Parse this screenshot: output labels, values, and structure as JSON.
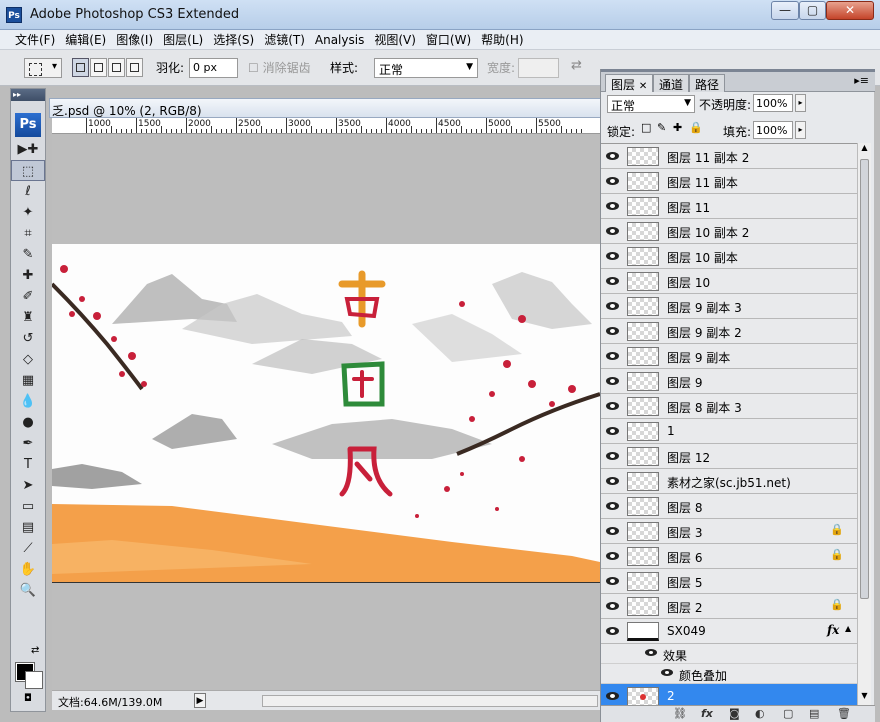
{
  "app": {
    "title": "Adobe Photoshop CS3 Extended",
    "icon_label": "Ps",
    "window_controls": {
      "minimize": "—",
      "maximize": "▢",
      "close": "✕"
    }
  },
  "menu": [
    "文件(F)",
    "编辑(E)",
    "图像(I)",
    "图层(L)",
    "选择(S)",
    "滤镜(T)",
    "Analysis",
    "视图(V)",
    "窗口(W)",
    "帮助(H)"
  ],
  "options": {
    "feather_label": "羽化:",
    "feather_value": "0 px",
    "antialias_label": "消除锯齿",
    "style_label": "样式:",
    "style_value": "正常",
    "width_label": "宽度:"
  },
  "tools": {
    "logo": "Ps",
    "grip": "▸▸",
    "items": [
      {
        "name": "move-tool-icon",
        "glyph": "▶✚"
      },
      {
        "name": "marquee-tool-icon",
        "glyph": "⬚"
      },
      {
        "name": "lasso-tool-icon",
        "glyph": "ℓ"
      },
      {
        "name": "magic-wand-tool-icon",
        "glyph": "✦"
      },
      {
        "name": "crop-tool-icon",
        "glyph": "⌗"
      },
      {
        "name": "slice-tool-icon",
        "glyph": "✎"
      },
      {
        "name": "healing-brush-tool-icon",
        "glyph": "✚"
      },
      {
        "name": "brush-tool-icon",
        "glyph": "✐"
      },
      {
        "name": "clone-stamp-tool-icon",
        "glyph": "♜"
      },
      {
        "name": "history-brush-tool-icon",
        "glyph": "↺"
      },
      {
        "name": "eraser-tool-icon",
        "glyph": "◇"
      },
      {
        "name": "gradient-tool-icon",
        "glyph": "▦"
      },
      {
        "name": "blur-tool-icon",
        "glyph": "💧"
      },
      {
        "name": "dodge-tool-icon",
        "glyph": "●"
      },
      {
        "name": "pen-tool-icon",
        "glyph": "✒"
      },
      {
        "name": "type-tool-icon",
        "glyph": "T"
      },
      {
        "name": "path-selection-tool-icon",
        "glyph": "➤"
      },
      {
        "name": "shape-tool-icon",
        "glyph": "▭"
      },
      {
        "name": "notes-tool-icon",
        "glyph": "▤"
      },
      {
        "name": "eyedropper-tool-icon",
        "glyph": "⟋"
      },
      {
        "name": "hand-tool-icon",
        "glyph": "✋"
      },
      {
        "name": "zoom-tool-icon",
        "glyph": "🔍"
      }
    ],
    "swap_colors": "⇄",
    "quick_mask": "◘"
  },
  "document": {
    "tab_title": "乏.psd @ 10% (2, RGB/8)",
    "ruler_labels": [
      "1000",
      "1500",
      "2000",
      "2500",
      "3000",
      "3500",
      "4000",
      "4500",
      "5000",
      "5500"
    ],
    "status": "文档:64.6M/139.0M",
    "status_arrow": "▶",
    "zoom_percent": 10
  },
  "layers_panel": {
    "tabs": [
      "图层",
      "通道",
      "路径"
    ],
    "tab_close": "✕",
    "menu_icon": "▸≡",
    "blend_mode": "正常",
    "opacity_label": "不透明度:",
    "opacity_value": "100%",
    "lock_label": "锁定:",
    "lock_icons": [
      "□",
      "✎",
      "✚",
      "🔒"
    ],
    "fill_label": "填充:",
    "fill_value": "100%",
    "spin_glyph": "▸",
    "lock_glyph": "🔒",
    "layers": [
      {
        "name": "图层 11 副本 2",
        "locked": false
      },
      {
        "name": "图层 11 副本",
        "locked": false
      },
      {
        "name": "图层 11",
        "locked": false
      },
      {
        "name": "图层 10 副本 2",
        "locked": false
      },
      {
        "name": "图层 10 副本",
        "locked": false
      },
      {
        "name": "图层 10",
        "locked": false
      },
      {
        "name": "图层 9 副本 3",
        "locked": false
      },
      {
        "name": "图层 9 副本 2",
        "locked": false
      },
      {
        "name": "图层 9 副本",
        "locked": false
      },
      {
        "name": "图层 9",
        "locked": false
      },
      {
        "name": "图层 8 副本 3",
        "locked": false
      },
      {
        "name": "1",
        "locked": false
      },
      {
        "name": "图层 12",
        "locked": false
      },
      {
        "name": "素材之家(sc.jb51.net)",
        "locked": false
      },
      {
        "name": "图层 8",
        "locked": false
      },
      {
        "name": "图层 3",
        "locked": true
      },
      {
        "name": "图层 6",
        "locked": true
      },
      {
        "name": "图层 5",
        "locked": false
      },
      {
        "name": "图层 2",
        "locked": true
      }
    ],
    "fx_layer": {
      "name": "SX049",
      "fx": "fx",
      "expand": "▲"
    },
    "effects_label": "效果",
    "effect_item": "颜色叠加",
    "selected_layer": "2",
    "footer_icons": [
      "⛓",
      "fx",
      "◙",
      "◐",
      "▢",
      "▤",
      "🗑"
    ],
    "scroll_up": "▲",
    "scroll_down": "▼"
  },
  "colors": {
    "selected_row": "#3388ee",
    "orange_strip": "#f4a04a",
    "accent_red": "#c8203a"
  }
}
